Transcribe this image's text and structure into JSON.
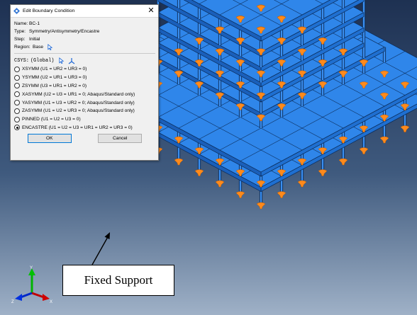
{
  "dialog": {
    "title": "Edit Boundary Condition",
    "close_glyph": "✕",
    "name_label": "Name:",
    "name_value": "BC-1",
    "type_label": "Type:",
    "type_value": "Symmetry/Antisymmetry/Encastre",
    "step_label": "Step:",
    "step_value": "Initial",
    "region_label": "Region:",
    "region_value": "Base",
    "region_icon": "select-arrow-icon",
    "csys_label": "CSYS:",
    "csys_value": "(Global)",
    "csys_icons": [
      "select-arrow-icon",
      "axes-icon"
    ],
    "options": [
      {
        "label": "XSYMM (U1 = UR2 = UR3 = 0)",
        "selected": false
      },
      {
        "label": "YSYMM (U2 = UR1 = UR3 = 0)",
        "selected": false
      },
      {
        "label": "ZSYMM (U3 = UR1 = UR2 = 0)",
        "selected": false
      },
      {
        "label": "XASYMM (U2 = U3 = UR1 = 0; Abaqus/Standard only)",
        "selected": false
      },
      {
        "label": "YASYMM (U1 = U3 = UR2 = 0; Abaqus/Standard only)",
        "selected": false
      },
      {
        "label": "ZASYMM (U1 = U2 = UR3 = 0; Abaqus/Standard only)",
        "selected": false
      },
      {
        "label": "PINNED (U1 = U2 = U3 = 0)",
        "selected": false
      },
      {
        "label": "ENCASTRE (U1 = U2 = U3 = UR1 = UR2 = UR3 = 0)",
        "selected": true
      }
    ],
    "ok_label": "OK",
    "cancel_label": "Cancel"
  },
  "annotation": {
    "text": "Fixed Support"
  },
  "triad": {
    "x": "X",
    "y": "Y",
    "z": "Z"
  },
  "colors": {
    "slab": "#2f86ea",
    "slab_edge": "#0b2a55",
    "support": "#ff8a1c",
    "bg_top": "#1e3152",
    "bg_bottom": "#9fb1c7"
  }
}
